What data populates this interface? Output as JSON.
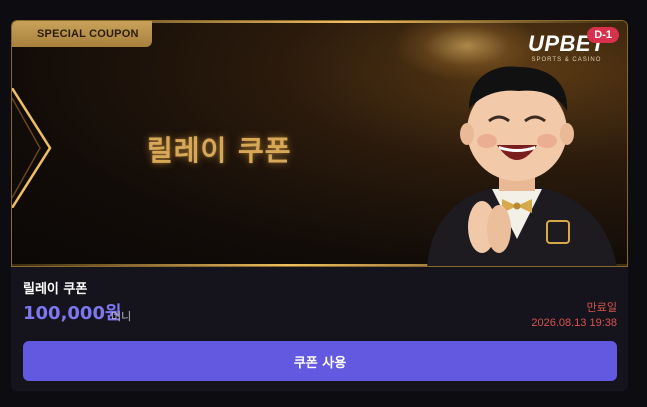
{
  "banner": {
    "badge_label": "SPECIAL COUPON",
    "title": "릴레이 쿠폰",
    "logo_main": "UPBET",
    "logo_sub": "SPORTS & CASINO",
    "dday_label": "D-1"
  },
  "coupon": {
    "name": "릴레이 쿠폰",
    "amount": "100,000원",
    "amount_unit": "머니",
    "expire_label": "만료일",
    "expire_date": "2026.08.13 19:38"
  },
  "actions": {
    "use_label": "쿠폰 사용"
  },
  "colors": {
    "accent": "#6359e0",
    "amount": "#7e77f2",
    "expire": "#d9534f",
    "gold": "#d7a857",
    "dday": "#d7314b"
  },
  "icons": {
    "mascot": "laughing-man-mascot-image",
    "chandelier": "chandelier-decoration"
  }
}
